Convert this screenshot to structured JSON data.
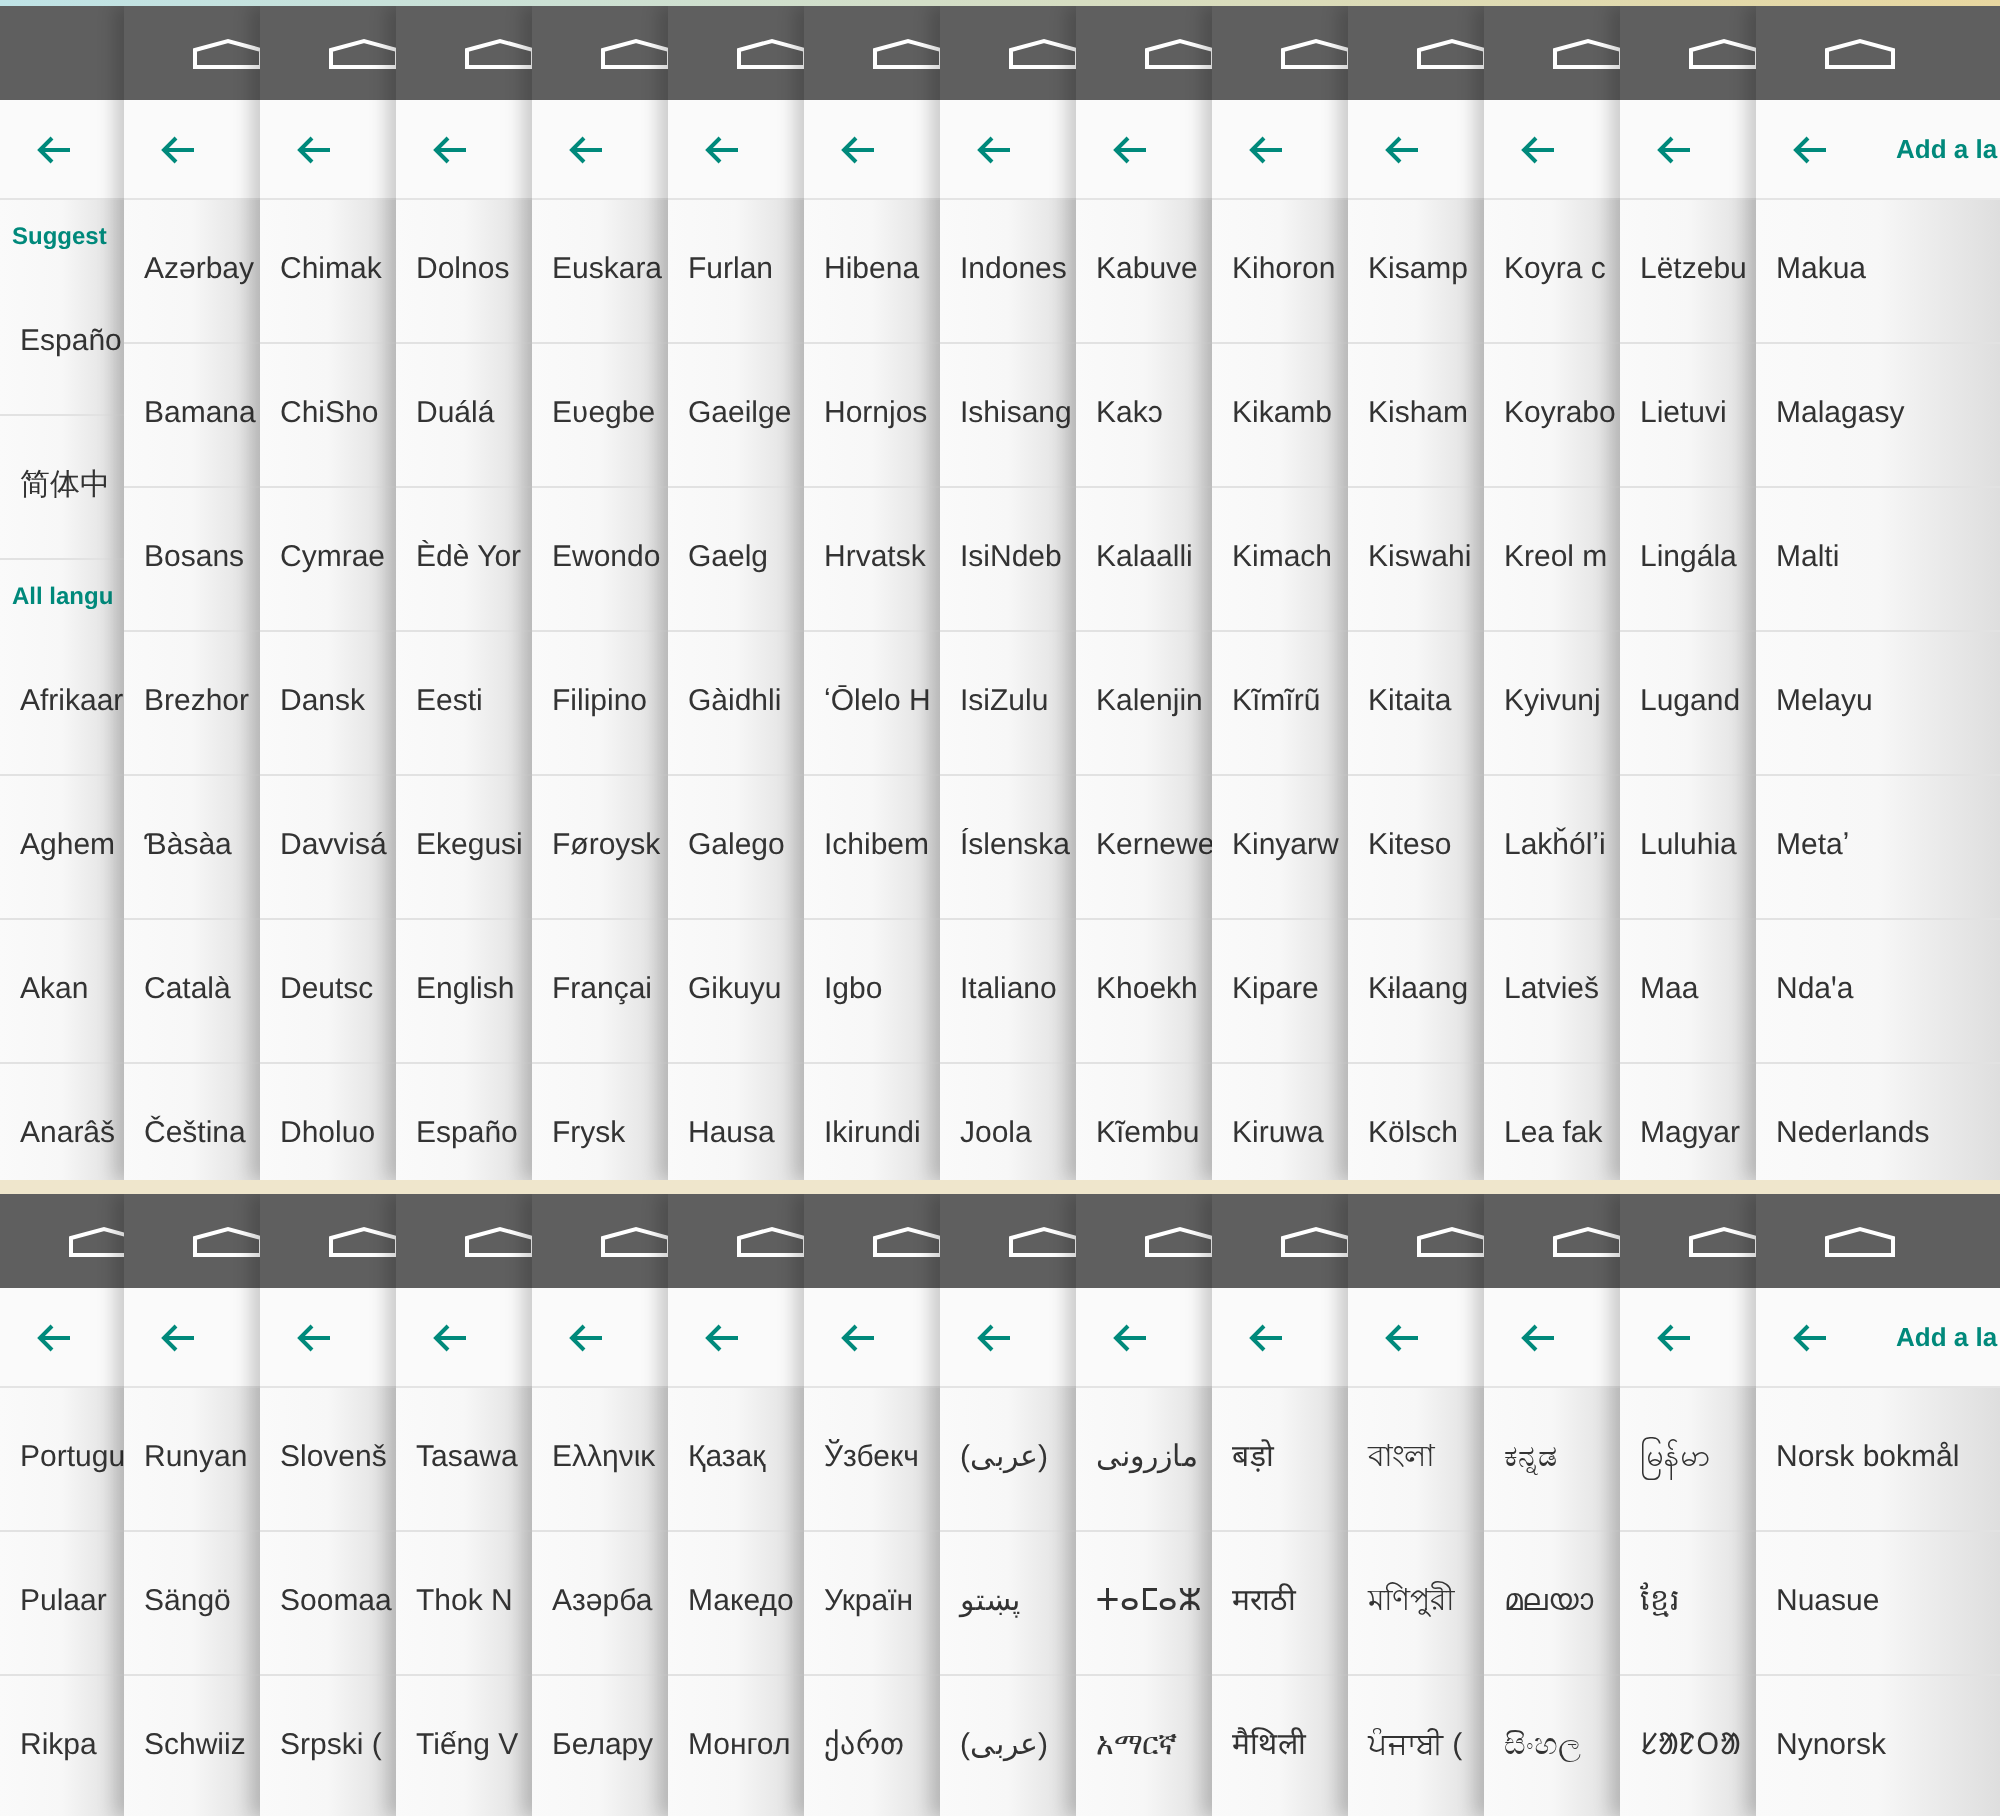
{
  "rows": [
    {
      "cards": [
        {
          "home_icon": false,
          "items": [
            {
              "kind": "section",
              "label": "Suggest"
            },
            {
              "kind": "language",
              "label": "Españo"
            },
            {
              "kind": "language",
              "label": "简体中"
            },
            {
              "kind": "section",
              "label": "All langu"
            },
            {
              "kind": "language",
              "label": "Afrikaar"
            },
            {
              "kind": "language",
              "label": "Aghem"
            },
            {
              "kind": "language",
              "label": "Akan"
            },
            {
              "kind": "language",
              "label": "Anarâš"
            }
          ]
        },
        {
          "home_icon": true,
          "items": [
            {
              "kind": "language",
              "label": "Azərbay"
            },
            {
              "kind": "language",
              "label": "Bamana"
            },
            {
              "kind": "language",
              "label": "Bosans"
            },
            {
              "kind": "language",
              "label": "Brezhor"
            },
            {
              "kind": "language",
              "label": "Ɓàsàa"
            },
            {
              "kind": "language",
              "label": "Català"
            },
            {
              "kind": "language",
              "label": "Čeština"
            }
          ]
        },
        {
          "home_icon": true,
          "items": [
            {
              "kind": "language",
              "label": "Chimak"
            },
            {
              "kind": "language",
              "label": "ChiSho"
            },
            {
              "kind": "language",
              "label": "Cymrae"
            },
            {
              "kind": "language",
              "label": "Dansk"
            },
            {
              "kind": "language",
              "label": "Davvisá"
            },
            {
              "kind": "language",
              "label": "Deutsc"
            },
            {
              "kind": "language",
              "label": "Dholuo"
            }
          ]
        },
        {
          "home_icon": true,
          "items": [
            {
              "kind": "language",
              "label": "Dolnos"
            },
            {
              "kind": "language",
              "label": "Duálá"
            },
            {
              "kind": "language",
              "label": "Èdè Yor"
            },
            {
              "kind": "language",
              "label": "Eesti"
            },
            {
              "kind": "language",
              "label": "Ekegusi"
            },
            {
              "kind": "language",
              "label": "English"
            },
            {
              "kind": "language",
              "label": "Españo"
            }
          ]
        },
        {
          "home_icon": true,
          "items": [
            {
              "kind": "language",
              "label": "Euskara"
            },
            {
              "kind": "language",
              "label": "Eʋegbe"
            },
            {
              "kind": "language",
              "label": "Ewondo"
            },
            {
              "kind": "language",
              "label": "Filipino"
            },
            {
              "kind": "language",
              "label": "Føroysk"
            },
            {
              "kind": "language",
              "label": "Françai"
            },
            {
              "kind": "language",
              "label": "Frysk"
            }
          ]
        },
        {
          "home_icon": true,
          "items": [
            {
              "kind": "language",
              "label": "Furlan"
            },
            {
              "kind": "language",
              "label": "Gaeilge"
            },
            {
              "kind": "language",
              "label": "Gaelg"
            },
            {
              "kind": "language",
              "label": "Gàidhli"
            },
            {
              "kind": "language",
              "label": "Galego"
            },
            {
              "kind": "language",
              "label": "Gikuyu"
            },
            {
              "kind": "language",
              "label": "Hausa"
            }
          ]
        },
        {
          "home_icon": true,
          "items": [
            {
              "kind": "language",
              "label": "Hibena"
            },
            {
              "kind": "language",
              "label": "Hornjos"
            },
            {
              "kind": "language",
              "label": "Hrvatsk"
            },
            {
              "kind": "language",
              "label": "ʻŌlelo H"
            },
            {
              "kind": "language",
              "label": "Ichibem"
            },
            {
              "kind": "language",
              "label": "Igbo"
            },
            {
              "kind": "language",
              "label": "Ikirundi"
            }
          ]
        },
        {
          "home_icon": true,
          "items": [
            {
              "kind": "language",
              "label": "Indones"
            },
            {
              "kind": "language",
              "label": "Ishisang"
            },
            {
              "kind": "language",
              "label": "IsiNdeb"
            },
            {
              "kind": "language",
              "label": "IsiZulu"
            },
            {
              "kind": "language",
              "label": "Íslenska"
            },
            {
              "kind": "language",
              "label": "Italiano"
            },
            {
              "kind": "language",
              "label": "Joola"
            }
          ]
        },
        {
          "home_icon": true,
          "items": [
            {
              "kind": "language",
              "label": "Kabuve"
            },
            {
              "kind": "language",
              "label": "Kakɔ"
            },
            {
              "kind": "language",
              "label": "Kalaalli"
            },
            {
              "kind": "language",
              "label": "Kalenjin"
            },
            {
              "kind": "language",
              "label": "Kernewe"
            },
            {
              "kind": "language",
              "label": "Khoekh"
            },
            {
              "kind": "language",
              "label": "Kĩembu"
            }
          ]
        },
        {
          "home_icon": true,
          "items": [
            {
              "kind": "language",
              "label": "Kihoron"
            },
            {
              "kind": "language",
              "label": "Kikamb"
            },
            {
              "kind": "language",
              "label": "Kimach"
            },
            {
              "kind": "language",
              "label": "Kĩmĩrũ"
            },
            {
              "kind": "language",
              "label": "Kinyarw"
            },
            {
              "kind": "language",
              "label": "Kipare"
            },
            {
              "kind": "language",
              "label": "Kiruwa"
            }
          ]
        },
        {
          "home_icon": true,
          "items": [
            {
              "kind": "language",
              "label": "Kisamp"
            },
            {
              "kind": "language",
              "label": "Kisham"
            },
            {
              "kind": "language",
              "label": "Kiswahi"
            },
            {
              "kind": "language",
              "label": "Kitaita"
            },
            {
              "kind": "language",
              "label": "Kiteso"
            },
            {
              "kind": "language",
              "label": "Kɨlaang"
            },
            {
              "kind": "language",
              "label": "Kölsch"
            }
          ]
        },
        {
          "home_icon": true,
          "items": [
            {
              "kind": "language",
              "label": "Koyra c"
            },
            {
              "kind": "language",
              "label": "Koyrabo"
            },
            {
              "kind": "language",
              "label": "Kreol m"
            },
            {
              "kind": "language",
              "label": "Kyivunj"
            },
            {
              "kind": "language",
              "label": "Lakȟólʼi"
            },
            {
              "kind": "language",
              "label": "Latvieš"
            },
            {
              "kind": "language",
              "label": "Lea fak"
            }
          ]
        },
        {
          "home_icon": true,
          "items": [
            {
              "kind": "language",
              "label": "Lëtzebu"
            },
            {
              "kind": "language",
              "label": "Lietuvi"
            },
            {
              "kind": "language",
              "label": "Lingála"
            },
            {
              "kind": "language",
              "label": "Lugand"
            },
            {
              "kind": "language",
              "label": "Luluhia"
            },
            {
              "kind": "language",
              "label": "Maa"
            },
            {
              "kind": "language",
              "label": "Magyar"
            }
          ]
        },
        {
          "home_icon": true,
          "title": "Add a la",
          "items": [
            {
              "kind": "language",
              "label": "Makua"
            },
            {
              "kind": "language",
              "label": "Malagasy"
            },
            {
              "kind": "language",
              "label": "Malti"
            },
            {
              "kind": "language",
              "label": "Melayu"
            },
            {
              "kind": "language",
              "label": "Metaʼ"
            },
            {
              "kind": "language",
              "label": "Ndaꞌa"
            },
            {
              "kind": "language",
              "label": "Nederlands"
            }
          ]
        }
      ]
    },
    {
      "cards": [
        {
          "home_icon": true,
          "items": [
            {
              "kind": "language",
              "label": "Portugu"
            },
            {
              "kind": "language",
              "label": "Pulaar"
            },
            {
              "kind": "language",
              "label": "Rikpa"
            }
          ]
        },
        {
          "home_icon": true,
          "items": [
            {
              "kind": "language",
              "label": "Runyan"
            },
            {
              "kind": "language",
              "label": "Sängö"
            },
            {
              "kind": "language",
              "label": "Schwiiz"
            }
          ]
        },
        {
          "home_icon": true,
          "items": [
            {
              "kind": "language",
              "label": "Slovenš"
            },
            {
              "kind": "language",
              "label": "Soomaa"
            },
            {
              "kind": "language",
              "label": "Srpski ("
            }
          ]
        },
        {
          "home_icon": true,
          "items": [
            {
              "kind": "language",
              "label": "Tasawa"
            },
            {
              "kind": "language",
              "label": "Thok N"
            },
            {
              "kind": "language",
              "label": "Tiếng V"
            }
          ]
        },
        {
          "home_icon": true,
          "items": [
            {
              "kind": "language",
              "label": "Ελληνικ"
            },
            {
              "kind": "language",
              "label": "Азәрба"
            },
            {
              "kind": "language",
              "label": "Белару"
            }
          ]
        },
        {
          "home_icon": true,
          "items": [
            {
              "kind": "language",
              "label": "Қазақ"
            },
            {
              "kind": "language",
              "label": "Македо"
            },
            {
              "kind": "language",
              "label": "Монгол"
            }
          ]
        },
        {
          "home_icon": true,
          "items": [
            {
              "kind": "language",
              "label": "Ўзбекч"
            },
            {
              "kind": "language",
              "label": "Україн"
            },
            {
              "kind": "language",
              "label": "ქართ"
            }
          ]
        },
        {
          "home_icon": true,
          "items": [
            {
              "kind": "language",
              "label": "(عربی)"
            },
            {
              "kind": "language",
              "label": "پښتو"
            },
            {
              "kind": "language",
              "label": "(عربی)"
            }
          ]
        },
        {
          "home_icon": true,
          "items": [
            {
              "kind": "language",
              "label": "مازرونی"
            },
            {
              "kind": "language",
              "label": "ⵜⴰⵎⴰⵣ"
            },
            {
              "kind": "language",
              "label": "አማርኛ"
            }
          ]
        },
        {
          "home_icon": true,
          "items": [
            {
              "kind": "language",
              "label": "बड़ो"
            },
            {
              "kind": "language",
              "label": "मराठी"
            },
            {
              "kind": "language",
              "label": "मैथिली"
            }
          ]
        },
        {
          "home_icon": true,
          "items": [
            {
              "kind": "language",
              "label": "বাংলা"
            },
            {
              "kind": "language",
              "label": "মণিপুরী"
            },
            {
              "kind": "language",
              "label": "ਪੰਜਾਬੀ ("
            }
          ]
        },
        {
          "home_icon": true,
          "items": [
            {
              "kind": "language",
              "label": "ಕನ್ನಡ"
            },
            {
              "kind": "language",
              "label": "മലയാ"
            },
            {
              "kind": "language",
              "label": "සිංහල"
            }
          ]
        },
        {
          "home_icon": true,
          "items": [
            {
              "kind": "language",
              "label": "မြန်မာ"
            },
            {
              "kind": "language",
              "label": "ខ្មែរ"
            },
            {
              "kind": "language",
              "label": "ᱥᱟᱱᱛᱟ"
            }
          ]
        },
        {
          "home_icon": true,
          "title": "Add a la",
          "items": [
            {
              "kind": "language",
              "label": "Norsk bokmål"
            },
            {
              "kind": "language",
              "label": "Nuasue"
            },
            {
              "kind": "language",
              "label": "Nynorsk"
            }
          ]
        }
      ]
    }
  ]
}
